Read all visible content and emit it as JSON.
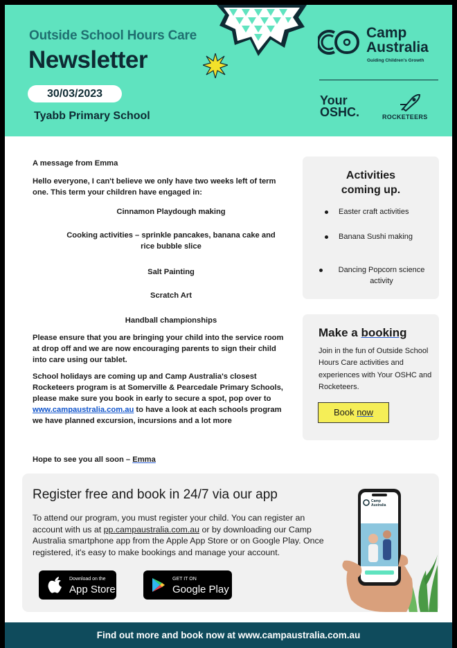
{
  "header": {
    "subtitle": "Outside School Hours Care",
    "title": "Newsletter",
    "date": "30/03/2023",
    "school": "Tyabb Primary School",
    "brand_line1": "Camp",
    "brand_line2": "Australia",
    "brand_tagline": "Guiding Children's Growth",
    "your": "Your",
    "oshc": "OSHC.",
    "rocketeers": "ROCKETEERS",
    "colors": {
      "header_bg": "#5fe3bf",
      "dark": "#0e2a33",
      "teal_text": "#1f6f70"
    }
  },
  "message": {
    "heading": "A message from Emma",
    "intro": "Hello everyone, I can't believe we only have two weeks left of term one. This term your children have engaged in:",
    "activities": [
      "Cinnamon Playdough making",
      "Cooking activities – sprinkle pancakes, banana cake and rice bubble slice",
      "Salt Painting",
      "Scratch Art",
      "Handball championships"
    ],
    "para1": "Please ensure that you are bringing your child into the service room at drop off and we are now encouraging parents to sign their child into care using our tablet.",
    "para2_before": "School holidays are coming up and Camp Australia's closest Rocketeers program is at Somerville & Pearcedale Primary Schools, please make sure you book in early to secure a spot, pop over to ",
    "para2_link": "www.campaustralia.com.au",
    "para2_after": " to have a look at each schools program we have planned excursion, incursions and a lot more",
    "signoff_before": "Hope to see you all soon – ",
    "signoff_name": "Emma"
  },
  "activities_panel": {
    "title_line1": "Activities",
    "title_line2": "coming up.",
    "items": [
      "Easter craft activities",
      "Banana Sushi making",
      "Dancing Popcorn science activity"
    ]
  },
  "booking_panel": {
    "title_plain": "Make a ",
    "title_underlined": "booking",
    "text": "Join in the fun of Outside School Hours Care activities and experiences with Your OSHC and Rocketeers.",
    "button_plain": "Book ",
    "button_underlined": "now",
    "button_color": "#f5ee57"
  },
  "register": {
    "title": "Register free and book in 24/7 via our app",
    "text_before": "To attend our program, you must register your child. You can register an account with us at ",
    "text_link": "pp.campaustralia.com.au",
    "text_after": " or by downloading our Camp Australia smartphone app from the Apple App Store or on Google Play. Once registered, it's easy to make bookings and manage your account.",
    "appstore_small": "Download on the",
    "appstore_big": "App Store",
    "googleplay_small": "GET IT ON",
    "googleplay_big": "Google Play",
    "phone_brand_line1": "Camp",
    "phone_brand_line2": "Australia"
  },
  "footer": {
    "text": "Find out more and book now at www.campaustralia.com.au",
    "color": "#0f4b5c"
  }
}
